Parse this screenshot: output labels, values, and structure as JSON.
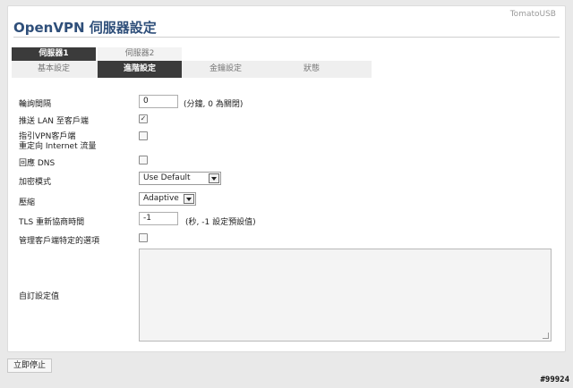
{
  "app": {
    "brand": "TomatoUSB",
    "title": "OpenVPN 伺服器設定"
  },
  "server_tabs": [
    {
      "label": "伺服器1",
      "active": true
    },
    {
      "label": "伺服器2",
      "active": false
    }
  ],
  "sub_tabs": [
    {
      "label": "基本設定",
      "active": false
    },
    {
      "label": "進階設定",
      "active": true
    },
    {
      "label": "金鑰設定",
      "active": false
    },
    {
      "label": "狀態",
      "active": false
    }
  ],
  "form": {
    "poll_interval": {
      "label": "輪詢間隔",
      "value": "0",
      "note": "(分鐘, 0 為關閉)"
    },
    "push_lan": {
      "label": "推送 LAN 至客戶端",
      "checked": true
    },
    "redirect_gateway": {
      "label_line1": "指引VPN客戶端",
      "label_line2": "重定向 Internet 流量",
      "checked": false
    },
    "respond_dns": {
      "label": "回應 DNS",
      "checked": false
    },
    "cipher": {
      "label": "加密模式",
      "value": "Use Default"
    },
    "compression": {
      "label": "壓縮",
      "value": "Adaptive"
    },
    "tls_renegotiation": {
      "label": "TLS 重新協商時間",
      "value": "-1",
      "note": "(秒, -1 設定預設值)"
    },
    "client_specific": {
      "label": "管理客戶端特定的選項",
      "checked": false
    },
    "custom_config": {
      "label": "自訂設定值",
      "value": ""
    }
  },
  "actions": {
    "stop_now": "立即停止"
  },
  "watermark": "#99924",
  "colors": {
    "title": "#2f4f7a",
    "active_tab": "#3b3b3b",
    "page_bg": "#e9e9e9"
  }
}
